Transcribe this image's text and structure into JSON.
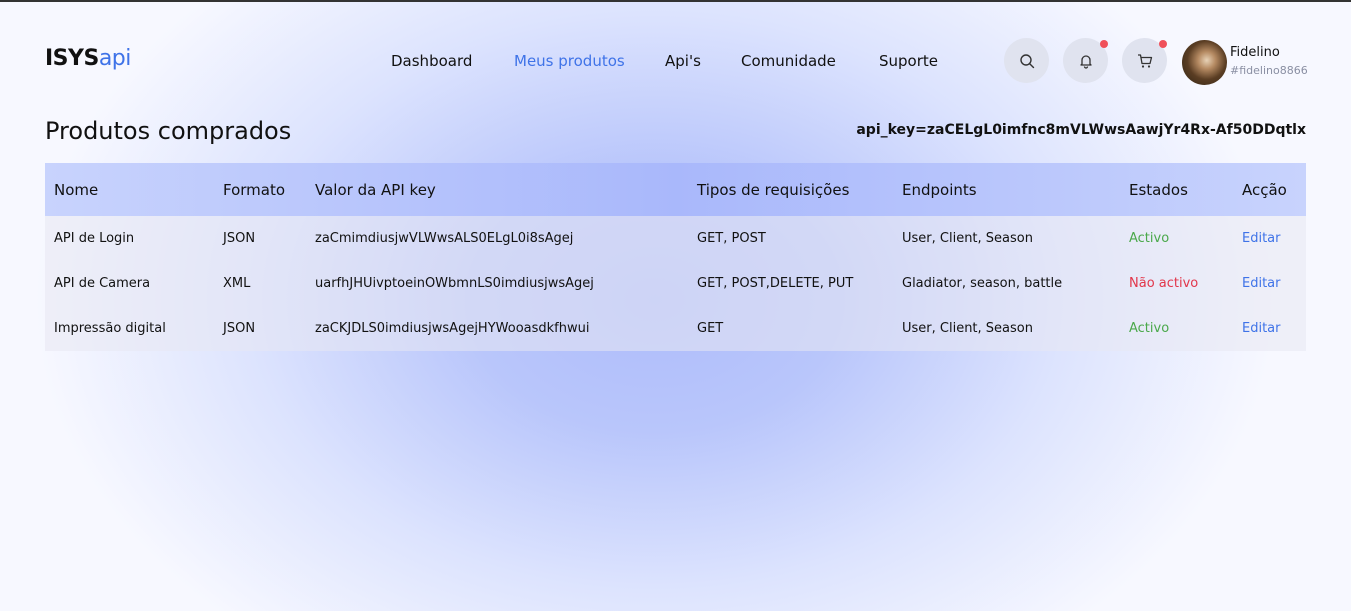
{
  "logo": {
    "part1": "ISYS",
    "part2": "api"
  },
  "nav": [
    "Dashboard",
    "Meus produtos",
    "Api's",
    "Comunidade",
    "Suporte"
  ],
  "nav_active": "Meus produtos",
  "icons": {
    "search": "search-icon",
    "notifications": "bell-icon",
    "cart": "cart-icon"
  },
  "user": {
    "name": "Fidelino",
    "handle": "#fidelino8866"
  },
  "page": {
    "title": "Produtos comprados",
    "api_key": "api_key=zaCELgL0imfnc8mVLWwsAawjYr4Rx-Af50DDqtlx"
  },
  "table": {
    "headers": [
      "Nome",
      "Formato",
      "Valor da API key",
      "Tipos de requisições",
      "Endpoints",
      "Estados",
      "Acção"
    ],
    "rows": [
      {
        "nome": "API de Login",
        "formato": "JSON",
        "key": "zaCmimdiusjwVLWwsALS0ELgL0i8sAgej",
        "tipos": "GET, POST",
        "endpoints": "User, Client, Season",
        "estado": "Activo",
        "accao": "Editar"
      },
      {
        "nome": "API de Camera",
        "formato": "XML",
        "key": "uarfhJHUivptoeinOWbmnLS0imdiusjwsAgej",
        "tipos": "GET, POST,DELETE, PUT",
        "endpoints": "Gladiator, season, battle",
        "estado": "Não activo",
        "accao": "Editar"
      },
      {
        "nome": "Impressão digital",
        "formato": "JSON",
        "key": "zaCKJDLS0imdiusjwsAgejHYWooasdkfhwui",
        "tipos": "GET",
        "endpoints": "User, Client, Season",
        "estado": "Activo",
        "accao": "Editar"
      }
    ]
  },
  "colors": {
    "accent": "#3f73e8",
    "active_status": "#4aa84a",
    "inactive_status": "#e2364a",
    "badge": "#f0505a"
  }
}
